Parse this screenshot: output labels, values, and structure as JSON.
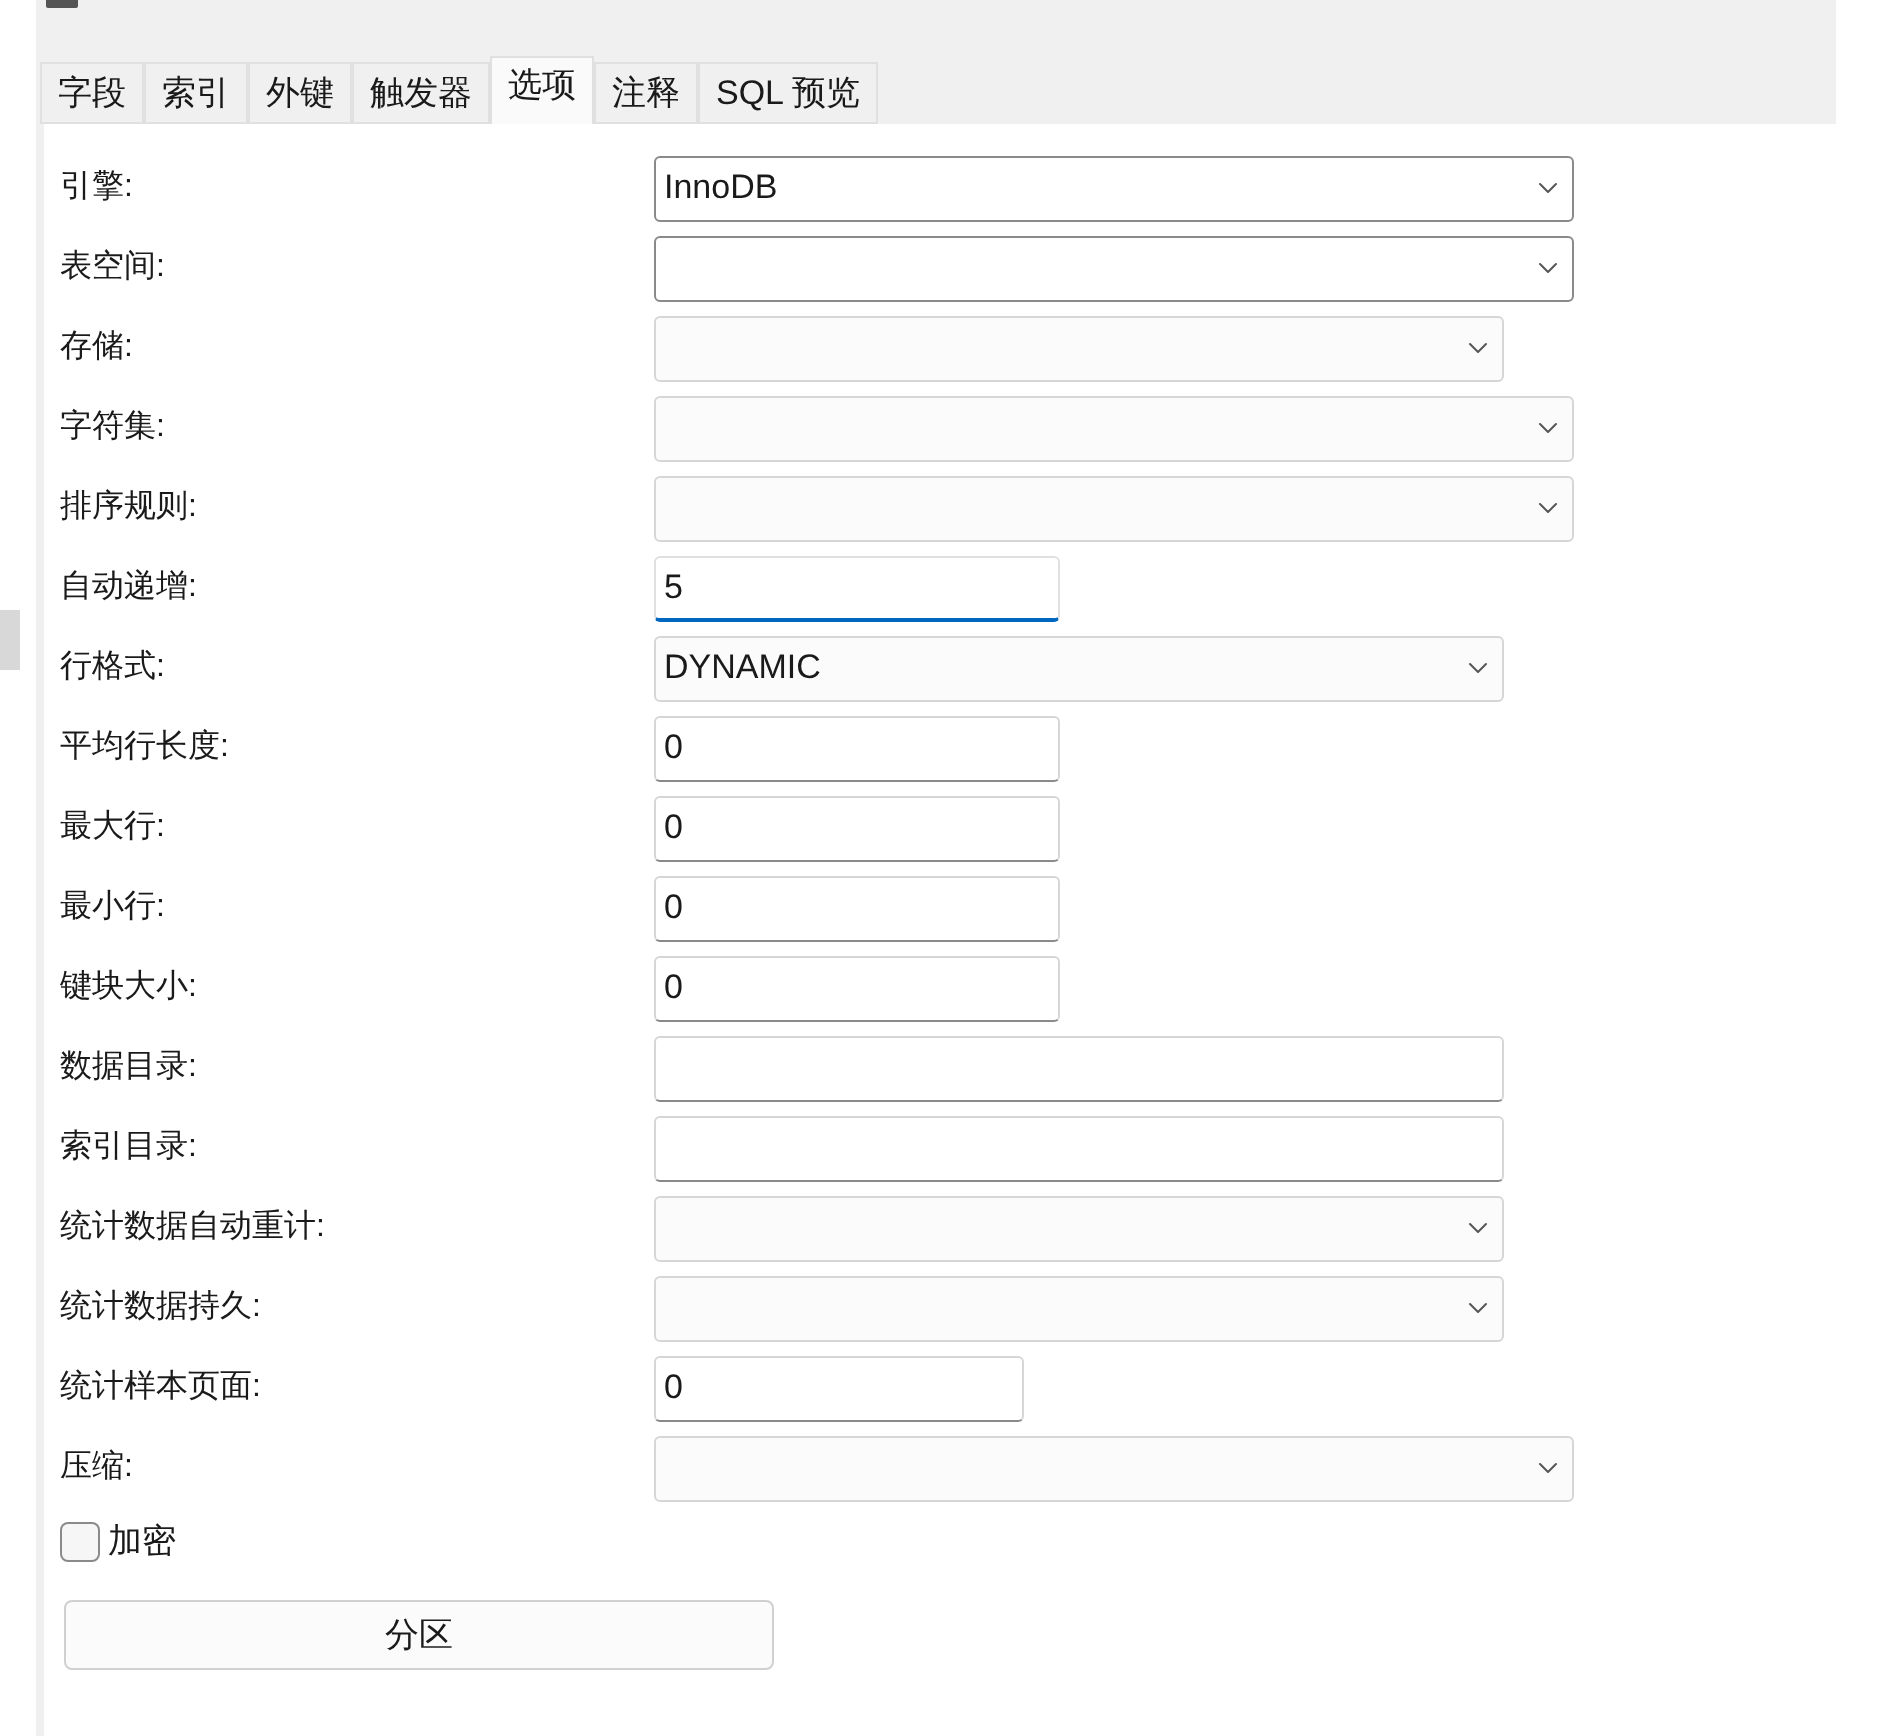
{
  "tabs": [
    {
      "label": "字段",
      "selected": false
    },
    {
      "label": "索引",
      "selected": false
    },
    {
      "label": "外键",
      "selected": false
    },
    {
      "label": "触发器",
      "selected": false
    },
    {
      "label": "选项",
      "selected": true
    },
    {
      "label": "注释",
      "selected": false
    },
    {
      "label": "SQL 预览",
      "selected": false
    }
  ],
  "fields": [
    {
      "label": "引擎:",
      "kind": "select",
      "value": "InnoDB",
      "focused": false
    },
    {
      "label": "表空间:",
      "kind": "select",
      "focused": false
    },
    {
      "label": "存储:",
      "kind": "select",
      "focused": false
    },
    {
      "label": "字符集:",
      "kind": "select",
      "focused": false
    },
    {
      "label": "排序规则:",
      "kind": "select",
      "focused": false
    },
    {
      "label": "自动递增:",
      "kind": "input",
      "value": "5",
      "focused": true
    },
    {
      "label": "行格式:",
      "kind": "select",
      "value": "DYNAMIC",
      "focused": false
    },
    {
      "label": "平均行长度:",
      "kind": "input",
      "value": "0",
      "focused": false
    },
    {
      "label": "最大行:",
      "kind": "input",
      "value": "0",
      "focused": false
    },
    {
      "label": "最小行:",
      "kind": "input",
      "value": "0",
      "focused": false
    },
    {
      "label": "键块大小:",
      "kind": "input",
      "value": "0",
      "focused": false
    },
    {
      "label": "数据目录:",
      "kind": "input",
      "focused": false
    },
    {
      "label": "索引目录:",
      "kind": "input",
      "focused": false
    },
    {
      "label": "统计数据自动重计:",
      "kind": "select",
      "focused": false
    },
    {
      "label": "统计数据持久:",
      "kind": "select",
      "focused": false
    },
    {
      "label": "统计样本页面:",
      "kind": "input",
      "value": "0",
      "focused": false
    },
    {
      "label": "压缩:",
      "kind": "select",
      "focused": false
    }
  ],
  "encrypt": {
    "label": "加密",
    "checked": false
  },
  "partition_button": "分区"
}
